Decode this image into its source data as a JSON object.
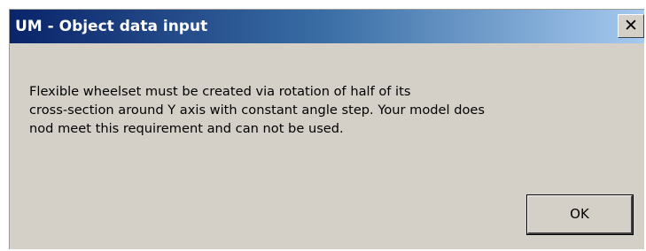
{
  "window": {
    "title": "UM - Object data input",
    "close_label": "✕"
  },
  "message": {
    "lines": [
      "Flexible wheelset must be created via rotation of half of its",
      "cross-section around Y axis with constant angle step. Your model does",
      "nod meet this requirement and can not be used."
    ]
  },
  "buttons": {
    "ok_label": "OK"
  },
  "colors": {
    "titlebar_start": "#0a246a",
    "titlebar_end": "#a6caf0",
    "dialog_background": "#d4d0c8"
  },
  "icons": {
    "close": "close-icon"
  }
}
